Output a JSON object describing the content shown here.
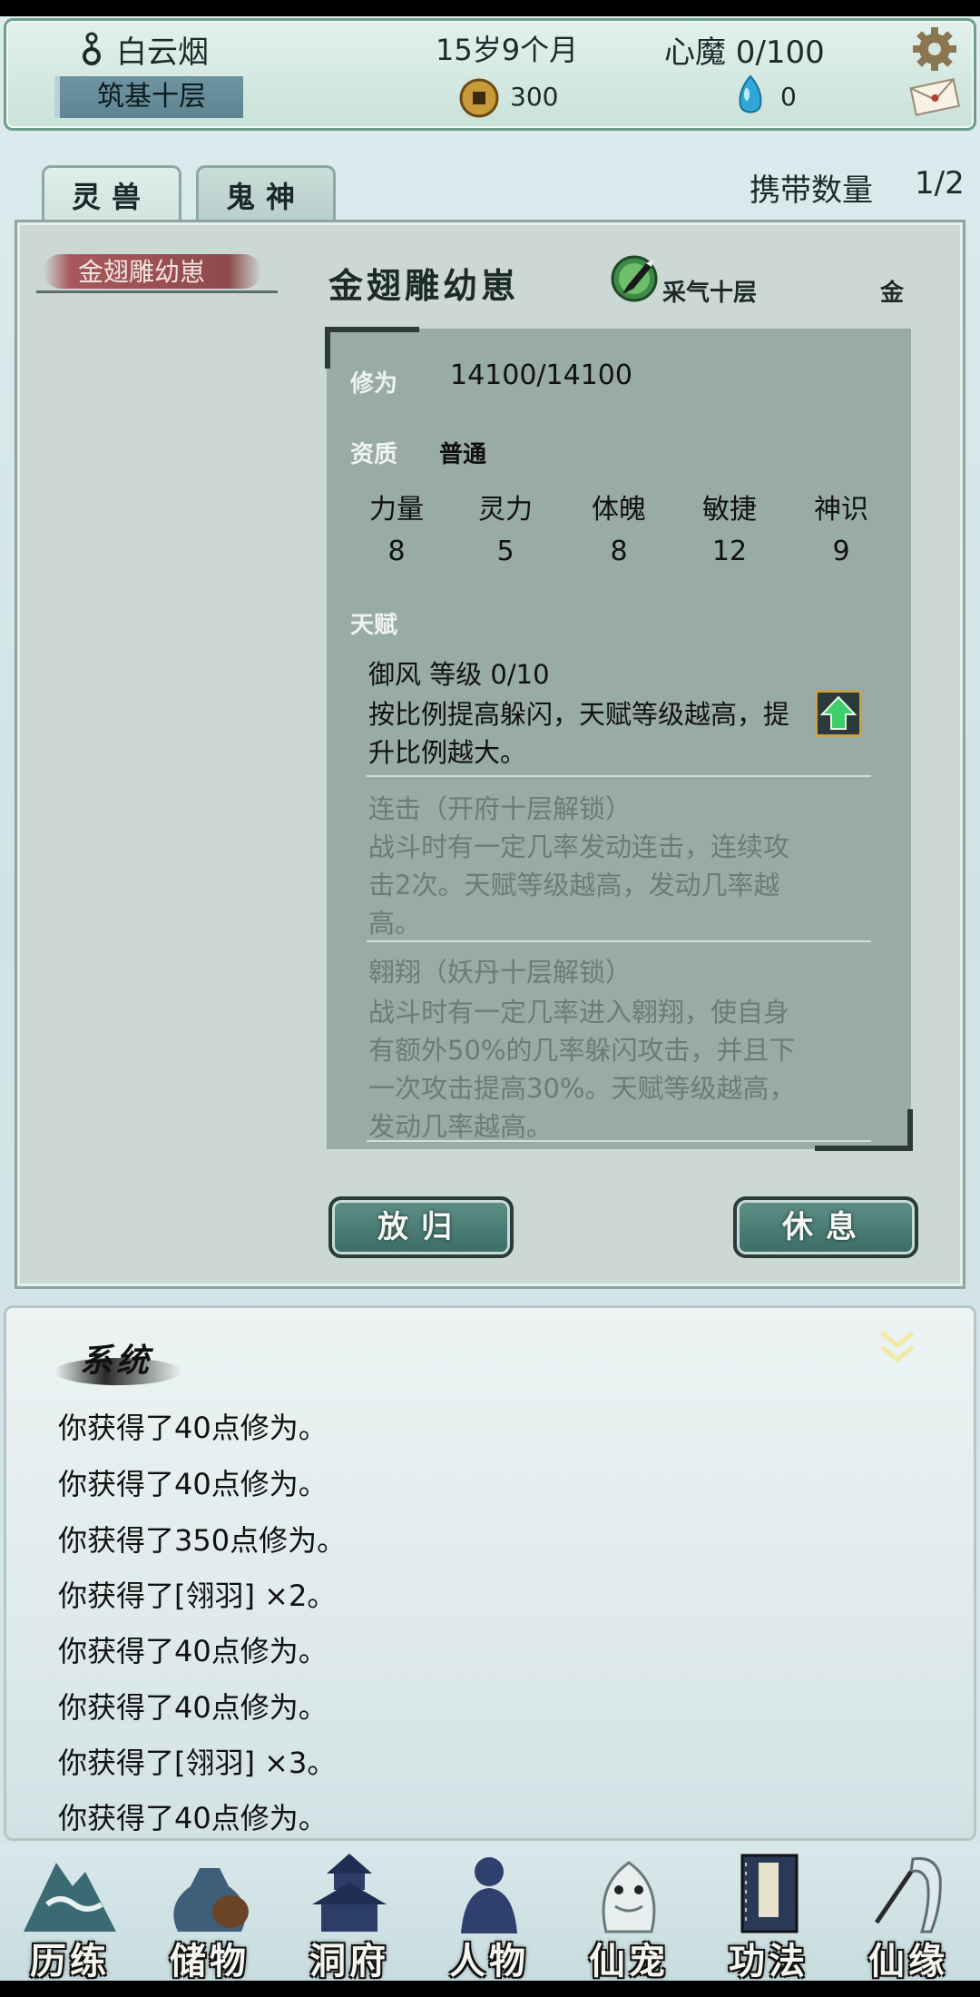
{
  "header": {
    "name": "白云烟",
    "realm": "筑基十层",
    "age": "15岁9个月",
    "demon": "心魔  0/100",
    "coins": "300",
    "gems": "0"
  },
  "tabs": [
    "灵兽",
    "鬼神"
  ],
  "carry": {
    "label": "携带数量",
    "value": "1/2"
  },
  "pet_list": [
    "金翅雕幼崽"
  ],
  "pet": {
    "name": "金翅雕幼崽",
    "realm": "采气十层",
    "element": "金",
    "cultivation_label": "修为",
    "cultivation": "14100/14100",
    "aptitude_label": "资质",
    "aptitude": "普通",
    "stats": [
      {
        "name": "力量",
        "value": "8"
      },
      {
        "name": "灵力",
        "value": "5"
      },
      {
        "name": "体魄",
        "value": "8"
      },
      {
        "name": "敏捷",
        "value": "12"
      },
      {
        "name": "神识",
        "value": "9"
      }
    ],
    "talent_label": "天赋",
    "talents": [
      {
        "title": "御风   等级  0/10",
        "desc": "按比例提高躲闪，天赋等级越高，提升比例越大。"
      },
      {
        "title": "连击（开府十层解锁）",
        "desc": "战斗时有一定几率发动连击，连续攻击2次。天赋等级越高，发动几率越高。"
      },
      {
        "title": "翱翔（妖丹十层解锁）",
        "desc": "战斗时有一定几率进入翱翔，使自身有额外50%的几率躲闪攻击，并且下一次攻击提高30%。天赋等级越高，发动几率越高。"
      }
    ]
  },
  "buttons": {
    "release": "放归",
    "rest": "休息"
  },
  "log": {
    "title": "系统",
    "lines": [
      "你获得了40点修为。",
      "你获得了40点修为。",
      "你获得了350点修为。",
      "你获得了[翎羽] ×2。",
      "你获得了40点修为。",
      "你获得了40点修为。",
      "你获得了[翎羽] ×3。",
      "你获得了40点修为。"
    ]
  },
  "nav": [
    "历练",
    "储物",
    "洞府",
    "人物",
    "仙宠",
    "功法",
    "仙缘"
  ]
}
